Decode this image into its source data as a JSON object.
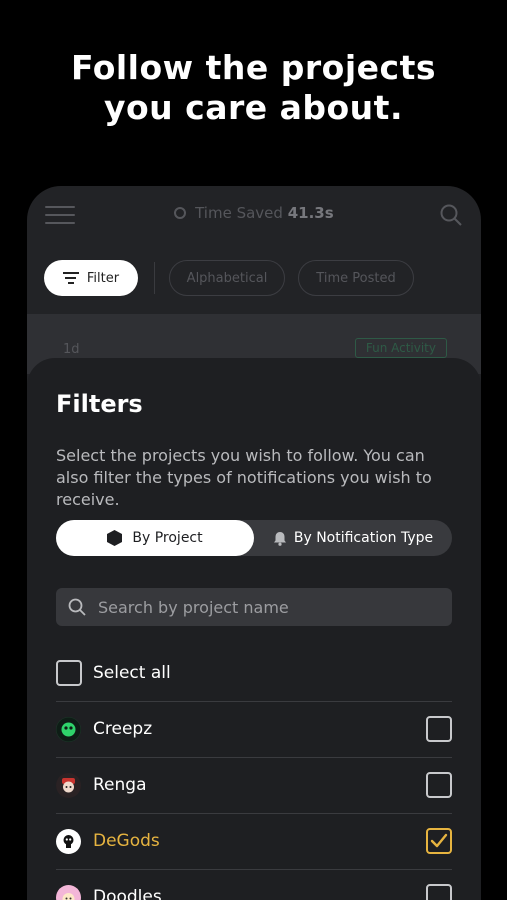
{
  "headline": {
    "line1": "Follow the projects",
    "line2": "you care about."
  },
  "topbar": {
    "time_saved_label": "Time Saved",
    "time_saved_value": "41.3s"
  },
  "chips": {
    "filter": "Filter",
    "alphabetical": "Alphabetical",
    "time_posted": "Time Posted"
  },
  "feed": {
    "age": "1d",
    "tag": "Fun Activity"
  },
  "sheet": {
    "title": "Filters",
    "description": "Select the projects you wish to follow. You can also filter the types of notifications you wish to receive.",
    "tabs": {
      "by_project": "By Project",
      "by_notification": "By Notification Type"
    },
    "search_placeholder": "Search by project name",
    "select_all": "Select all",
    "projects": [
      {
        "name": "Creepz",
        "checked": false,
        "avatar_color": "#1d3a2a",
        "icon": "creepz-avatar-icon"
      },
      {
        "name": "Renga",
        "checked": false,
        "avatar_color": "#2a2224",
        "icon": "renga-avatar-icon"
      },
      {
        "name": "DeGods",
        "checked": true,
        "avatar_color": "#ffffff",
        "icon": "degods-avatar-icon"
      },
      {
        "name": "Doodles",
        "checked": false,
        "avatar_color": "#f3b6d8",
        "icon": "doodles-avatar-icon"
      }
    ]
  },
  "colors": {
    "accent": "#e7b440",
    "background": "#000000",
    "sheet": "#1e1f22"
  }
}
